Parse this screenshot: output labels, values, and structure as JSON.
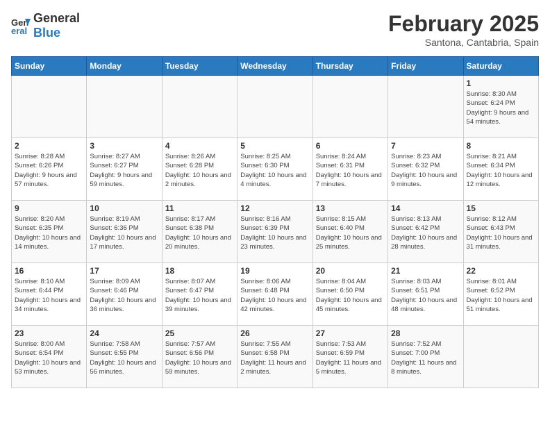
{
  "logo": {
    "general": "General",
    "blue": "Blue"
  },
  "title": "February 2025",
  "subtitle": "Santona, Cantabria, Spain",
  "days_of_week": [
    "Sunday",
    "Monday",
    "Tuesday",
    "Wednesday",
    "Thursday",
    "Friday",
    "Saturday"
  ],
  "weeks": [
    [
      {
        "day": "",
        "info": ""
      },
      {
        "day": "",
        "info": ""
      },
      {
        "day": "",
        "info": ""
      },
      {
        "day": "",
        "info": ""
      },
      {
        "day": "",
        "info": ""
      },
      {
        "day": "",
        "info": ""
      },
      {
        "day": "1",
        "info": "Sunrise: 8:30 AM\nSunset: 6:24 PM\nDaylight: 9 hours and 54 minutes."
      }
    ],
    [
      {
        "day": "2",
        "info": "Sunrise: 8:28 AM\nSunset: 6:26 PM\nDaylight: 9 hours and 57 minutes."
      },
      {
        "day": "3",
        "info": "Sunrise: 8:27 AM\nSunset: 6:27 PM\nDaylight: 9 hours and 59 minutes."
      },
      {
        "day": "4",
        "info": "Sunrise: 8:26 AM\nSunset: 6:28 PM\nDaylight: 10 hours and 2 minutes."
      },
      {
        "day": "5",
        "info": "Sunrise: 8:25 AM\nSunset: 6:30 PM\nDaylight: 10 hours and 4 minutes."
      },
      {
        "day": "6",
        "info": "Sunrise: 8:24 AM\nSunset: 6:31 PM\nDaylight: 10 hours and 7 minutes."
      },
      {
        "day": "7",
        "info": "Sunrise: 8:23 AM\nSunset: 6:32 PM\nDaylight: 10 hours and 9 minutes."
      },
      {
        "day": "8",
        "info": "Sunrise: 8:21 AM\nSunset: 6:34 PM\nDaylight: 10 hours and 12 minutes."
      }
    ],
    [
      {
        "day": "9",
        "info": "Sunrise: 8:20 AM\nSunset: 6:35 PM\nDaylight: 10 hours and 14 minutes."
      },
      {
        "day": "10",
        "info": "Sunrise: 8:19 AM\nSunset: 6:36 PM\nDaylight: 10 hours and 17 minutes."
      },
      {
        "day": "11",
        "info": "Sunrise: 8:17 AM\nSunset: 6:38 PM\nDaylight: 10 hours and 20 minutes."
      },
      {
        "day": "12",
        "info": "Sunrise: 8:16 AM\nSunset: 6:39 PM\nDaylight: 10 hours and 23 minutes."
      },
      {
        "day": "13",
        "info": "Sunrise: 8:15 AM\nSunset: 6:40 PM\nDaylight: 10 hours and 25 minutes."
      },
      {
        "day": "14",
        "info": "Sunrise: 8:13 AM\nSunset: 6:42 PM\nDaylight: 10 hours and 28 minutes."
      },
      {
        "day": "15",
        "info": "Sunrise: 8:12 AM\nSunset: 6:43 PM\nDaylight: 10 hours and 31 minutes."
      }
    ],
    [
      {
        "day": "16",
        "info": "Sunrise: 8:10 AM\nSunset: 6:44 PM\nDaylight: 10 hours and 34 minutes."
      },
      {
        "day": "17",
        "info": "Sunrise: 8:09 AM\nSunset: 6:46 PM\nDaylight: 10 hours and 36 minutes."
      },
      {
        "day": "18",
        "info": "Sunrise: 8:07 AM\nSunset: 6:47 PM\nDaylight: 10 hours and 39 minutes."
      },
      {
        "day": "19",
        "info": "Sunrise: 8:06 AM\nSunset: 6:48 PM\nDaylight: 10 hours and 42 minutes."
      },
      {
        "day": "20",
        "info": "Sunrise: 8:04 AM\nSunset: 6:50 PM\nDaylight: 10 hours and 45 minutes."
      },
      {
        "day": "21",
        "info": "Sunrise: 8:03 AM\nSunset: 6:51 PM\nDaylight: 10 hours and 48 minutes."
      },
      {
        "day": "22",
        "info": "Sunrise: 8:01 AM\nSunset: 6:52 PM\nDaylight: 10 hours and 51 minutes."
      }
    ],
    [
      {
        "day": "23",
        "info": "Sunrise: 8:00 AM\nSunset: 6:54 PM\nDaylight: 10 hours and 53 minutes."
      },
      {
        "day": "24",
        "info": "Sunrise: 7:58 AM\nSunset: 6:55 PM\nDaylight: 10 hours and 56 minutes."
      },
      {
        "day": "25",
        "info": "Sunrise: 7:57 AM\nSunset: 6:56 PM\nDaylight: 10 hours and 59 minutes."
      },
      {
        "day": "26",
        "info": "Sunrise: 7:55 AM\nSunset: 6:58 PM\nDaylight: 11 hours and 2 minutes."
      },
      {
        "day": "27",
        "info": "Sunrise: 7:53 AM\nSunset: 6:59 PM\nDaylight: 11 hours and 5 minutes."
      },
      {
        "day": "28",
        "info": "Sunrise: 7:52 AM\nSunset: 7:00 PM\nDaylight: 11 hours and 8 minutes."
      },
      {
        "day": "",
        "info": ""
      }
    ]
  ]
}
